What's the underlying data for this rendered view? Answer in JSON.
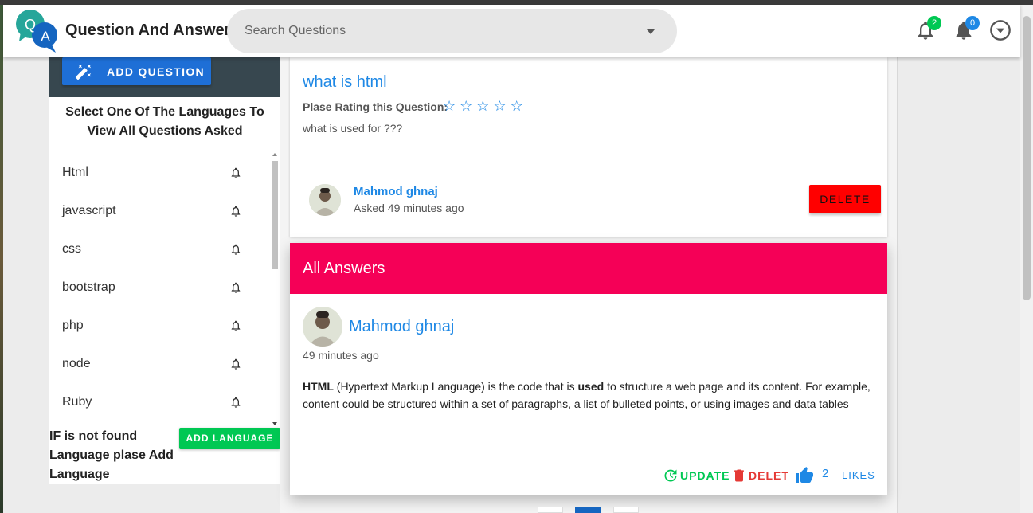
{
  "app": {
    "title": "Question And Answer",
    "logo_letters": [
      "Q",
      "A"
    ]
  },
  "search": {
    "placeholder": "Search Questions"
  },
  "header": {
    "notifications_badge": "2",
    "messages_badge": "0",
    "badge_colors": {
      "notifications": "#00c853",
      "messages": "#1e88e5"
    }
  },
  "sidebar": {
    "add_question_label": "ADD QUESTION",
    "heading": "Select One Of The Languages To View All Questions Asked",
    "languages": [
      {
        "name": "Html"
      },
      {
        "name": "javascript"
      },
      {
        "name": "css"
      },
      {
        "name": "bootstrap"
      },
      {
        "name": "php"
      },
      {
        "name": "node"
      },
      {
        "name": "Ruby"
      }
    ],
    "not_found_text": "IF is not found Language plase Add Language",
    "add_language_label": "ADD LANGUAGE"
  },
  "question": {
    "title": "what is html",
    "rating_label": "Plase Rating this Question:",
    "rating_value": 0,
    "rating_max": 5,
    "body": "what is used for ???",
    "author": "Mahmod ghnaj",
    "asked": "Asked 49 minutes ago",
    "delete_label": "DELETE"
  },
  "answers": {
    "header": "All Answers",
    "items": [
      {
        "author": "Mahmod ghnaj",
        "time": "49 minutes ago",
        "body_bold_1": "HTML",
        "body_text_1": " (Hypertext Markup Language) is the code that is ",
        "body_bold_2": "used",
        "body_text_2": " to structure a web page and its content. For example, content could be structured within a set of paragraphs, a list of bulleted points, or using images and data tables",
        "update_label": "UPDATE",
        "delete_label": "DELET",
        "likes_count": "2",
        "likes_label": "LIKES"
      }
    ]
  },
  "colors": {
    "primary": "#1e88e5",
    "accent_pink": "#f50057",
    "danger": "#ff0000",
    "success": "#00c853",
    "sidebar_dark": "#37474f"
  }
}
